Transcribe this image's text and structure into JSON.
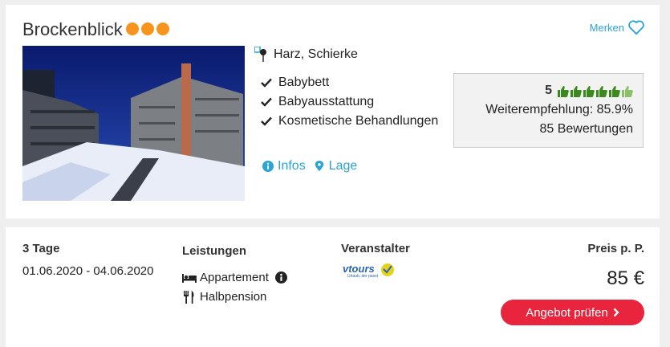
{
  "hotel": {
    "name": "Brockenblick",
    "stars_count": 3,
    "star_color": "#f7941d",
    "location": "Harz, Schierke",
    "bookmark_label": "Merken",
    "amenities": [
      "Babybett",
      "Babyausstattung",
      "Kosmetische Behandlungen"
    ],
    "links": {
      "infos": "Infos",
      "lage": "Lage"
    }
  },
  "rating": {
    "score": "5",
    "thumbs_full": 5,
    "thumbs_total": 6,
    "recommendation": "Weiterempfehlung: 85.9%",
    "reviews": "85 Bewertungen"
  },
  "offer": {
    "duration_title": "3 Tage",
    "dates": "01.06.2020 - 04.06.2020",
    "services_title": "Leistungen",
    "room": "Appartement",
    "board": "Halbpension",
    "operator_title": "Veranstalter",
    "operator_logo_text": "vtours",
    "operator_logo_tagline": "Urlaub, der passt",
    "price_title": "Preis p. P.",
    "price": "85 €",
    "cta_label": "Angebot prüfen"
  },
  "colors": {
    "accent_blue": "#2aa3d6",
    "cta_red": "#e8253c",
    "thumb_green": "#3c8a1e"
  }
}
